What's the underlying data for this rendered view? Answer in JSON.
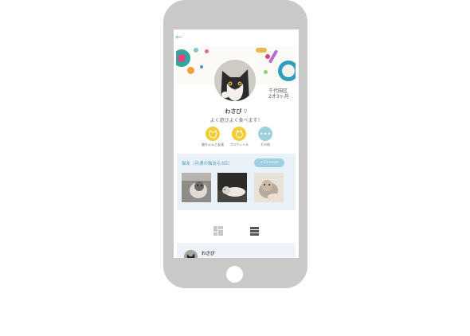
{
  "header": {
    "back_label": "←"
  },
  "profile": {
    "name": "わさび",
    "sex_symbol": "♀",
    "tagline": "よく遊びよく食べます！",
    "location": "千代田区",
    "age": "2才3ヶ月"
  },
  "actions": [
    {
      "label": "猫ちゃんと友達",
      "icon": "cat-face-icon",
      "color": "#f3cd35"
    },
    {
      "label": "プロフィール",
      "icon": "cat-profile-icon",
      "color": "#f3cd35"
    },
    {
      "label": "その他",
      "icon": "more-dots-icon",
      "glyph": "•••",
      "color": "#9fd0dd"
    }
  ],
  "friends": {
    "title": "猫友（共通の猫友も3匹）",
    "more_label": "+23 more"
  },
  "view_toggle": {
    "grid": "grid-view-icon",
    "list": "list-view-icon"
  },
  "post": {
    "author": "わさび"
  }
}
